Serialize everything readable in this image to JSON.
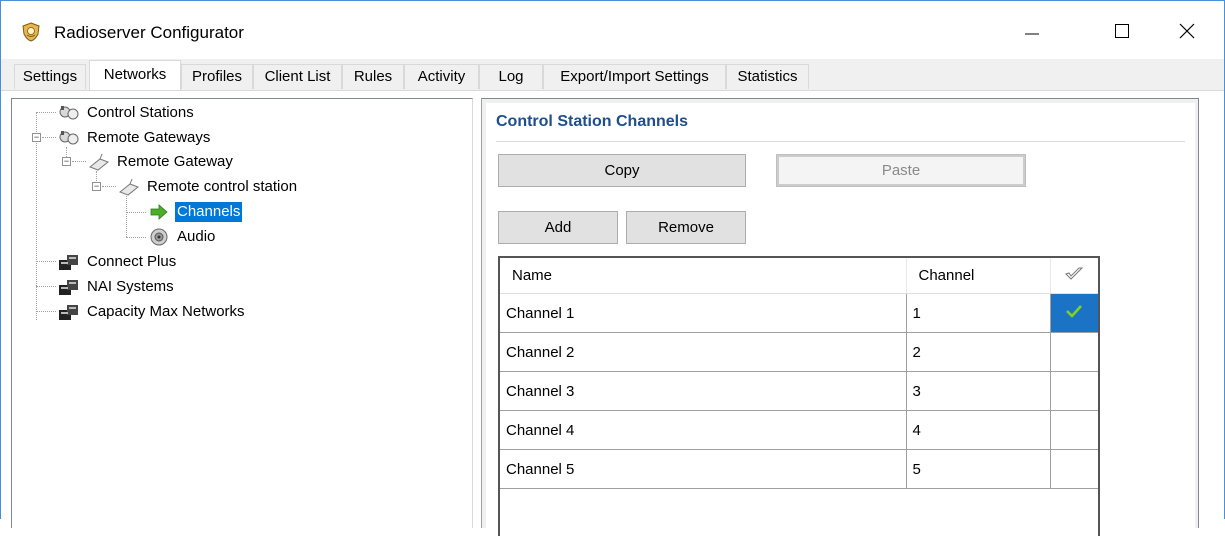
{
  "window": {
    "title": "Radioserver Configurator",
    "app_icon": "radio-shield-icon",
    "controls": [
      "minimize",
      "maximize",
      "close"
    ]
  },
  "tabs": [
    {
      "label": "Settings",
      "active": false
    },
    {
      "label": "Networks",
      "active": true
    },
    {
      "label": "Profiles",
      "active": false
    },
    {
      "label": "Client List",
      "active": false
    },
    {
      "label": "Rules",
      "active": false
    },
    {
      "label": "Activity",
      "active": false
    },
    {
      "label": "Log",
      "active": false
    },
    {
      "label": "Export/Import Settings",
      "active": false
    },
    {
      "label": "Statistics",
      "active": false
    }
  ],
  "tree": {
    "control_stations": "Control Stations",
    "remote_gateways": "Remote Gateways",
    "remote_gateway": "Remote Gateway",
    "remote_control_station": "Remote control station",
    "channels": "Channels",
    "audio": "Audio",
    "connect_plus": "Connect Plus",
    "nai_systems": "NAI Systems",
    "capacity_max": "Capacity Max Networks",
    "selected": "Channels"
  },
  "panel": {
    "title": "Control Station Channels",
    "copy_label": "Copy",
    "paste_label": "Paste",
    "paste_enabled": false,
    "add_label": "Add",
    "remove_label": "Remove"
  },
  "grid": {
    "columns": [
      "Name",
      "Channel",
      ""
    ],
    "check_header_icon": "checkmark-outline-icon",
    "rows": [
      {
        "name": "Channel 1",
        "channel": "1",
        "checked": true
      },
      {
        "name": "Channel 2",
        "channel": "2",
        "checked": false
      },
      {
        "name": "Channel 3",
        "channel": "3",
        "checked": false
      },
      {
        "name": "Channel 4",
        "channel": "4",
        "checked": false
      },
      {
        "name": "Channel 5",
        "channel": "5",
        "checked": false
      }
    ]
  },
  "colors": {
    "selection": "#0078d7",
    "section_title": "#1e4e8c",
    "check_cell": "#1a73c5",
    "check_mark": "#7ed321"
  }
}
